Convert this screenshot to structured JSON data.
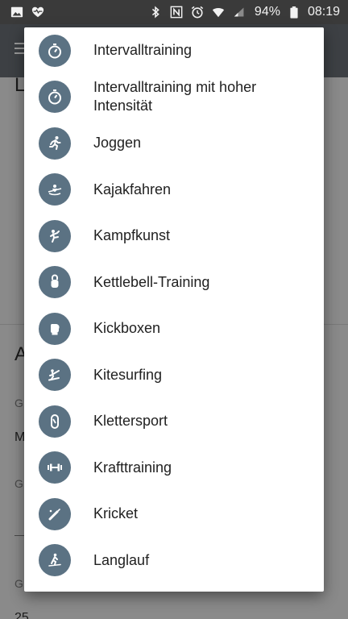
{
  "status_bar": {
    "battery_percent": "94%",
    "time": "08:19",
    "icons_left": [
      "image-icon",
      "heart-pulse-icon"
    ],
    "icons_right": [
      "bluetooth-icon",
      "nfc-icon",
      "alarm-icon",
      "wifi-icon",
      "signal-icon",
      "battery-icon"
    ]
  },
  "background_app": {
    "heading_1": "L",
    "heading_2": "A",
    "row_a_small": "G",
    "row_a_value": "M",
    "row_b_small": "G",
    "row_c_small": "G",
    "row_d_value": "25"
  },
  "dialog": {
    "items": [
      {
        "label": "Intervalltraining",
        "icon": "stopwatch-icon"
      },
      {
        "label": "Intervalltraining mit hoher Intensität",
        "icon": "stopwatch-icon"
      },
      {
        "label": "Joggen",
        "icon": "running-icon"
      },
      {
        "label": "Kajakfahren",
        "icon": "kayak-icon"
      },
      {
        "label": "Kampfkunst",
        "icon": "martial-arts-icon"
      },
      {
        "label": "Kettlebell-Training",
        "icon": "kettlebell-icon"
      },
      {
        "label": "Kickboxen",
        "icon": "boxing-glove-icon"
      },
      {
        "label": "Kitesurfing",
        "icon": "kitesurf-icon"
      },
      {
        "label": "Klettersport",
        "icon": "climbing-carabiner-icon"
      },
      {
        "label": "Krafttraining",
        "icon": "dumbbell-icon"
      },
      {
        "label": "Kricket",
        "icon": "cricket-bat-icon"
      },
      {
        "label": "Langlauf",
        "icon": "cross-country-ski-icon"
      }
    ]
  },
  "colors": {
    "avatar_bg": "#5b7283",
    "status_bar_bg": "#3a3a3a",
    "dialog_bg": "#ffffff",
    "label_text": "#212121"
  }
}
